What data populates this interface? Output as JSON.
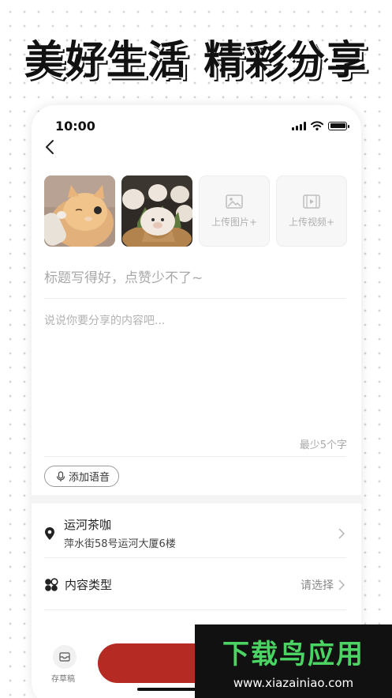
{
  "headline": "美好生活  精彩分享",
  "status_bar": {
    "time": "10:00"
  },
  "media": {
    "upload_image_label": "上传图片+",
    "upload_video_label": "上传视频+"
  },
  "editor": {
    "title_placeholder": "标题写得好，点赞少不了~",
    "body_placeholder": "说说你要分享的内容吧...",
    "min_hint": "最少5个字",
    "voice_label": "添加语音"
  },
  "location": {
    "name": "运河茶咖",
    "address": "萍水街58号运河大厦6楼"
  },
  "content_type": {
    "label": "内容类型",
    "value": "请选择"
  },
  "bottom_bar": {
    "draft_label": "存草稿",
    "publish_color": "#b52a22"
  },
  "watermark": {
    "title": "下载鸟应用",
    "url": "www.xiazainiao.com",
    "accent": "#4bd463"
  }
}
